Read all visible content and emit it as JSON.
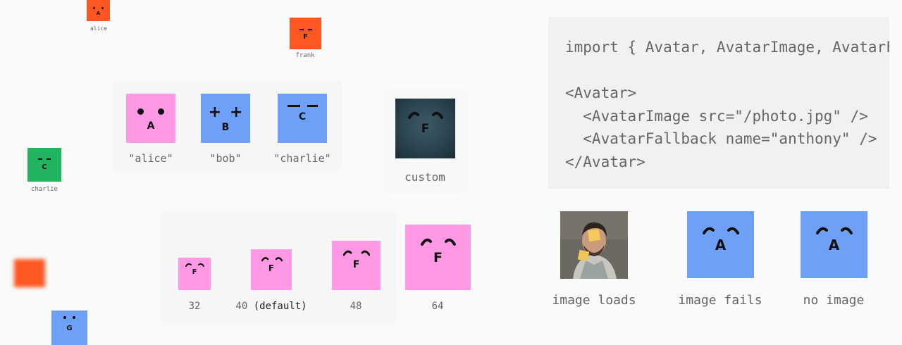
{
  "floating_avatars": [
    {
      "letter": "A",
      "label": "alice",
      "color": "#ff5722"
    },
    {
      "letter": "F",
      "label": "frank",
      "color": "#ff5722"
    },
    {
      "letter": "C",
      "label": "charlie",
      "color": "#22b35e"
    },
    {
      "letter": "",
      "label": "",
      "color": "#ff5722"
    },
    {
      "letter": "G",
      "label": "",
      "color": "#6ea0f7"
    }
  ],
  "seed_demo": {
    "items": [
      {
        "letter": "A",
        "label": "\"alice\"",
        "color": "#ff99e6"
      },
      {
        "letter": "B",
        "label": "\"bob\"",
        "color": "#6ea0f7"
      },
      {
        "letter": "C",
        "label": "\"charlie\"",
        "color": "#6ea0f7"
      }
    ]
  },
  "custom_demo": {
    "letter": "F",
    "label": "custom",
    "color": "#2b4450"
  },
  "size_demo": {
    "items": [
      {
        "letter": "F",
        "label": "32",
        "color": "#ff99e6"
      },
      {
        "letter": "F",
        "label": "40",
        "extra": "(default)",
        "color": "#ff99e6"
      },
      {
        "letter": "F",
        "label": "48",
        "color": "#ff99e6"
      },
      {
        "letter": "F",
        "label": "64",
        "color": "#ff99e6"
      }
    ]
  },
  "code_block": {
    "line1": "import { Avatar, AvatarImage, AvatarFallback }",
    "line2": "",
    "line3": "<Avatar>",
    "line4": "  <AvatarImage src=\"/photo.jpg\" />",
    "line5": "  <AvatarFallback name=\"anthony\" />",
    "line6": "</Avatar>"
  },
  "fallback_demo": {
    "items": [
      {
        "label": "image loads",
        "type": "photo"
      },
      {
        "label": "image fails",
        "letter": "A",
        "color": "#6ea0f7"
      },
      {
        "label": "no image",
        "letter": "A",
        "color": "#6ea0f7"
      }
    ]
  }
}
